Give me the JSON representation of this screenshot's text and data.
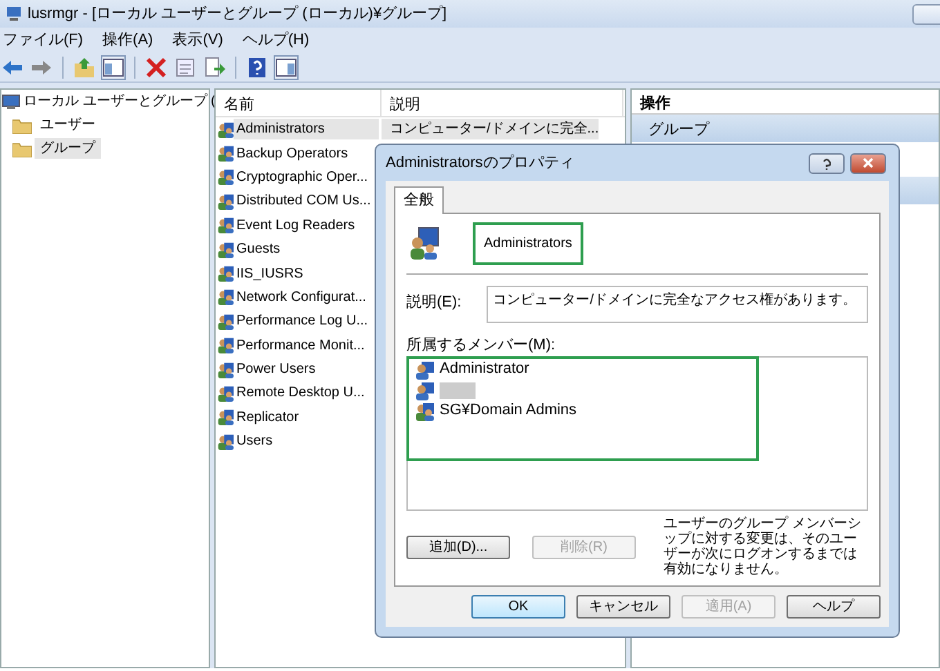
{
  "window": {
    "title": "lusrmgr - [ローカル ユーザーとグループ (ローカル)¥グループ]"
  },
  "menu": [
    "ファイル(F)",
    "操作(A)",
    "表示(V)",
    "ヘルプ(H)"
  ],
  "toolbar": [
    {
      "kind": "back",
      "pressed": false
    },
    {
      "kind": "forward",
      "pressed": false
    },
    {
      "kind": "sep"
    },
    {
      "kind": "up",
      "pressed": false
    },
    {
      "kind": "tree",
      "pressed": true
    },
    {
      "kind": "sep"
    },
    {
      "kind": "delete",
      "pressed": false
    },
    {
      "kind": "properties",
      "pressed": false
    },
    {
      "kind": "export",
      "pressed": false
    },
    {
      "kind": "sep"
    },
    {
      "kind": "help",
      "pressed": false
    },
    {
      "kind": "actionpane",
      "pressed": true
    }
  ],
  "tree": {
    "label": "ローカル ユーザーとグループ (",
    "children": [
      {
        "label": "ユーザー",
        "selected": false
      },
      {
        "label": "グループ",
        "selected": true
      }
    ]
  },
  "list": {
    "columns": [
      "名前",
      "説明"
    ],
    "rows": [
      {
        "name": "Administrators",
        "description": "コンピューター/ドメインに完全...",
        "selected": true
      },
      {
        "name": "Backup Operators",
        "selected": false
      },
      {
        "name": "Cryptographic Oper...",
        "selected": false
      },
      {
        "name": "Distributed COM Us...",
        "selected": false
      },
      {
        "name": "Event Log Readers",
        "selected": false
      },
      {
        "name": "Guests",
        "selected": false
      },
      {
        "name": "IIS_IUSRS",
        "selected": false
      },
      {
        "name": "Network Configurat...",
        "selected": false
      },
      {
        "name": "Performance Log U...",
        "selected": false
      },
      {
        "name": "Performance Monit...",
        "selected": false
      },
      {
        "name": "Power Users",
        "selected": false
      },
      {
        "name": "Remote Desktop U...",
        "selected": false
      },
      {
        "name": "Replicator",
        "selected": false
      },
      {
        "name": "Users",
        "selected": false
      }
    ]
  },
  "actions": {
    "title": "操作",
    "sections": [
      {
        "label": "グループ",
        "selected": true
      }
    ]
  },
  "dialog": {
    "title": "Administratorsのプロパティ",
    "tabs": [
      {
        "label": "全般",
        "selected": true
      }
    ],
    "name": {
      "value": "Administrators",
      "highlighted": true
    },
    "description": {
      "label": "説明(E):",
      "value": "コンピューター/ドメインに完全なアクセス権があります。"
    },
    "members": {
      "label": "所属するメンバー(M):",
      "highlighted": true,
      "items": [
        {
          "kind": "user",
          "name": "Administrator"
        },
        {
          "kind": "user",
          "redacted": true
        },
        {
          "kind": "group",
          "name": "SG¥Domain Admins"
        }
      ]
    },
    "member_buttons": [
      {
        "label": "追加(D)...",
        "disabled": false
      },
      {
        "label": "削除(R)",
        "disabled": true
      }
    ],
    "note": "ユーザーのグループ メンバーシップに対する変更は、そのユーザーが次にログオンするまでは有効になりません。",
    "buttons": [
      {
        "label": "OK",
        "default": true,
        "disabled": false
      },
      {
        "label": "キャンセル",
        "default": false,
        "disabled": false
      },
      {
        "label": "適用(A)",
        "default": false,
        "disabled": true
      },
      {
        "label": "ヘルプ",
        "default": false,
        "disabled": false
      }
    ]
  }
}
